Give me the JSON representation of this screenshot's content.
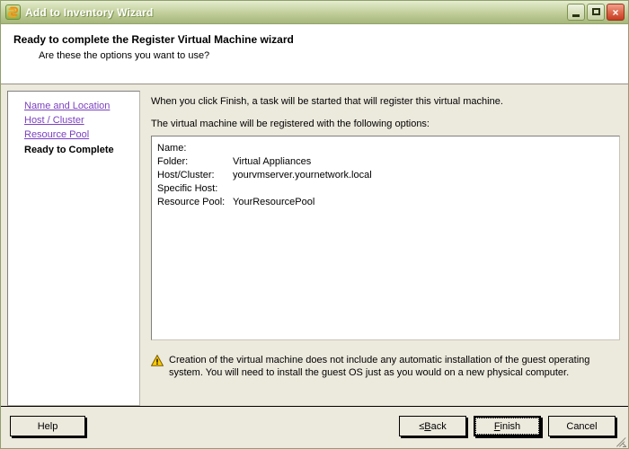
{
  "window": {
    "title": "Add to Inventory Wizard",
    "icon": "wizard-link-icon",
    "buttons": {
      "minimize": "Minimize",
      "maximize": "Maximize",
      "close": "×"
    },
    "frame_color": "#aebb8a",
    "titlebar_gradient_top": "#e9eed6",
    "titlebar_gradient_bottom": "#a6b77d"
  },
  "header": {
    "title": "Ready to complete the Register Virtual Machine wizard",
    "subtitle": "Are these the options you want to use?"
  },
  "sidebar": {
    "items": [
      {
        "label": "Name and Location",
        "state": "link"
      },
      {
        "label": "Host / Cluster",
        "state": "link"
      },
      {
        "label": "Resource Pool",
        "state": "link"
      },
      {
        "label": "Ready to Complete",
        "state": "current"
      }
    ],
    "link_color": "#7B3FBF",
    "current_color": "#000000"
  },
  "content": {
    "intro_line_1": "When you click Finish, a task will be started that will register this virtual machine.",
    "intro_line_2": "The virtual machine will be registered with the following options:",
    "options": [
      {
        "label": "Name:",
        "value": ""
      },
      {
        "label": "Folder:",
        "value": "Virtual Appliances"
      },
      {
        "label": "Host/Cluster:",
        "value": "yourvmserver.yournetwork.local"
      },
      {
        "label": "Specific Host:",
        "value": ""
      },
      {
        "label": "Resource Pool:",
        "value": "YourResourcePool"
      }
    ],
    "warning": {
      "icon": "warning-triangle-icon",
      "icon_color": "#FFCC00",
      "text": "Creation of the virtual machine does not include any automatic installation of the guest operating system. You will need to install the guest OS just as you would on a new physical computer."
    }
  },
  "footer": {
    "help": "Help",
    "back_prefix": "≤ ",
    "back_accel": "B",
    "back_suffix": "ack",
    "finish_accel": "F",
    "finish_suffix": "inish",
    "cancel": "Cancel"
  }
}
